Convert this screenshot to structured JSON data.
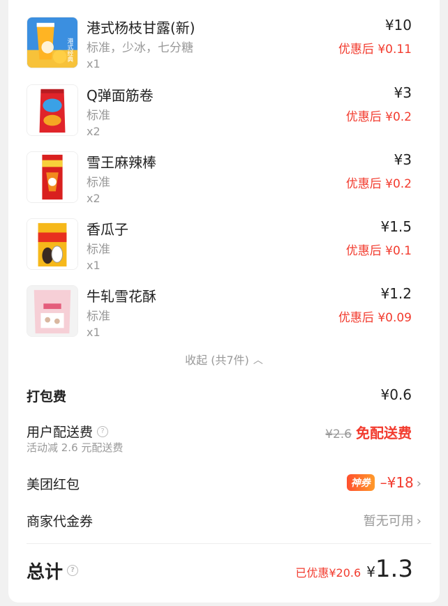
{
  "items": [
    {
      "name": "港式杨枝甘露(新)",
      "spec": "标准，少冰，七分糖",
      "qty": "x1",
      "price": "¥10",
      "after": "优惠后 ¥0.11",
      "icon": "mango-drink-icon"
    },
    {
      "name": "Q弹面筋卷",
      "spec": "标准",
      "qty": "x2",
      "price": "¥3",
      "after": "优惠后 ¥0.2",
      "icon": "snack-bag-icon"
    },
    {
      "name": "雪王麻辣棒",
      "spec": "标准",
      "qty": "x2",
      "price": "¥3",
      "after": "优惠后 ¥0.2",
      "icon": "snack-bag-icon"
    },
    {
      "name": "香瓜子",
      "spec": "标准",
      "qty": "x1",
      "price": "¥1.5",
      "after": "优惠后 ¥0.1",
      "icon": "seed-bag-icon"
    },
    {
      "name": "牛轧雪花酥",
      "spec": "标准",
      "qty": "x1",
      "price": "¥1.2",
      "after": "优惠后 ¥0.09",
      "icon": "pastry-bag-icon"
    }
  ],
  "collapse_label": "收起 (共7件)",
  "packing": {
    "label": "打包费",
    "value": "¥0.6"
  },
  "delivery": {
    "label": "用户配送费",
    "original": "¥2.6",
    "value": "免配送费",
    "note": "活动减 2.6 元配送费"
  },
  "redpacket": {
    "label": "美团红包",
    "badge": "神券",
    "value": "–¥18"
  },
  "voucher": {
    "label": "商家代金券",
    "value": "暂无可用"
  },
  "total": {
    "label": "总计",
    "saved": "已优惠¥20.6",
    "symbol": "¥",
    "amount": "1.3"
  },
  "colors": {
    "accent_red": "#f23b2e",
    "badge_from": "#ff4f2e",
    "badge_to": "#ff9a2a"
  }
}
